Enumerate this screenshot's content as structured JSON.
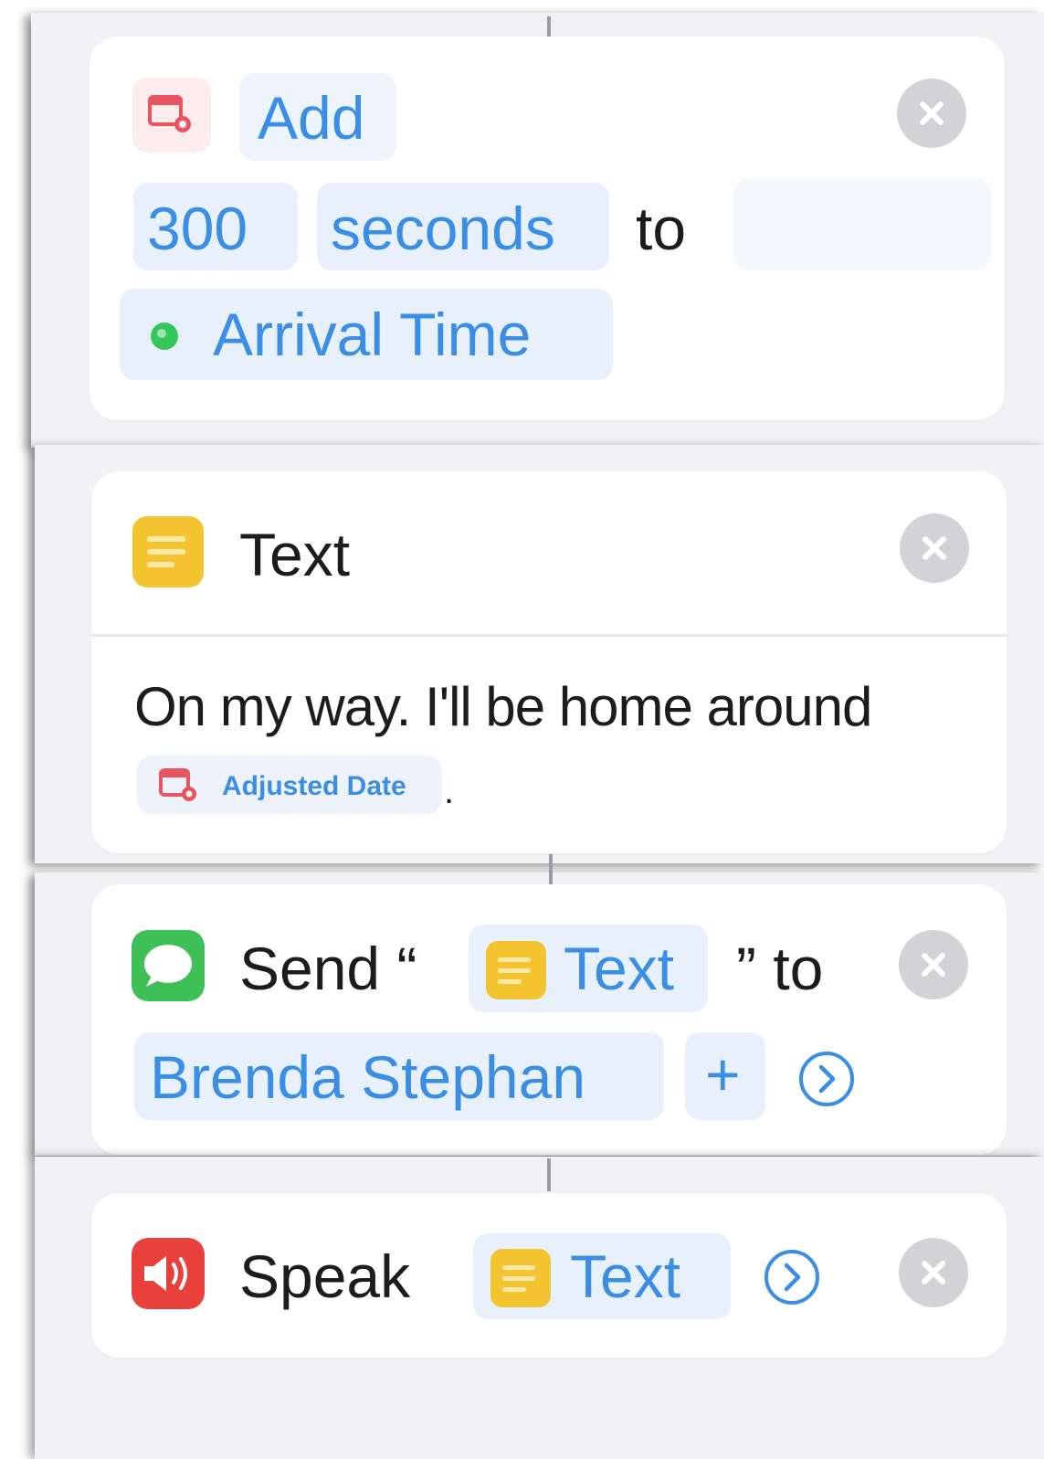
{
  "actions": {
    "add": {
      "verb": "Add",
      "amount": "300",
      "unit": "seconds",
      "connector": "to",
      "variable": "Arrival Time"
    },
    "text": {
      "title": "Text",
      "body": "On my way. I'll be home around",
      "variable": "Adjusted Date",
      "period": "."
    },
    "send": {
      "verb": "Send “",
      "variable": "Text",
      "close_quote_to": "” to",
      "recipient": "Brenda Stephan",
      "add_symbol": "+"
    },
    "speak": {
      "verb": "Speak",
      "variable": "Text"
    }
  },
  "colors": {
    "accent": "#3a8ee6",
    "calendar_icon": "#e8555f",
    "text_icon": "#f4c430",
    "messages_icon": "#3fc057",
    "speak_icon": "#e8413c",
    "location_dot": "#34c759",
    "close_button": "#d3d3d7"
  },
  "icons": [
    "calendar-icon",
    "location-icon",
    "text-note-icon",
    "messages-icon",
    "speaker-icon",
    "chevron-circle-icon",
    "close-icon"
  ]
}
